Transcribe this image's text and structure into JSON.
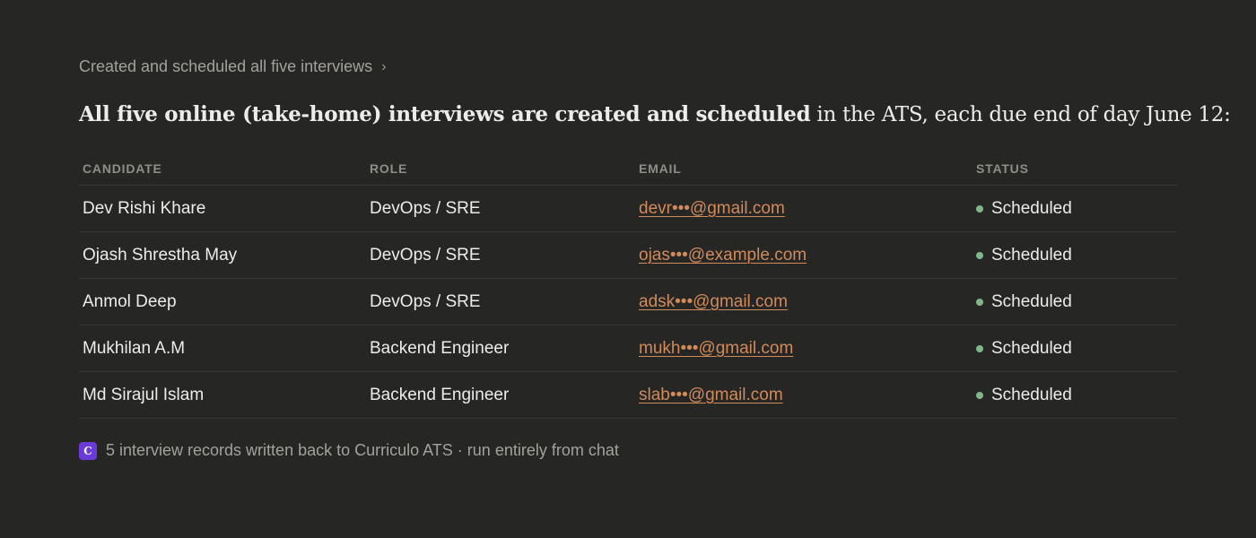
{
  "breadcrumb": {
    "label": "Created and scheduled all five interviews",
    "chevron": "›"
  },
  "headline": {
    "bold": "All five online (take-home) interviews are created and scheduled",
    "rest": " in the ATS, each due end of day June 12:"
  },
  "table": {
    "headers": {
      "candidate": "CANDIDATE",
      "role": "ROLE",
      "email": "EMAIL",
      "status": "STATUS"
    },
    "rows": [
      {
        "candidate": "Dev Rishi Khare",
        "role": "DevOps / SRE",
        "email": "devr•••@gmail.com",
        "status": "Scheduled"
      },
      {
        "candidate": "Ojash Shrestha May",
        "role": "DevOps / SRE",
        "email": "ojas•••@example.com",
        "status": "Scheduled"
      },
      {
        "candidate": "Anmol Deep",
        "role": "DevOps / SRE",
        "email": "adsk•••@gmail.com",
        "status": "Scheduled"
      },
      {
        "candidate": "Mukhilan A.M",
        "role": "Backend Engineer",
        "email": "mukh•••@gmail.com",
        "status": "Scheduled"
      },
      {
        "candidate": "Md Sirajul Islam",
        "role": "Backend Engineer",
        "email": "slab•••@gmail.com",
        "status": "Scheduled"
      }
    ]
  },
  "footer": {
    "logo_letter": "C",
    "text": "5 interview records written back to Curriculo ATS · run entirely from chat"
  },
  "colors": {
    "background": "#262624",
    "email_link": "#d08a5c",
    "status_dot": "#7fb78a",
    "logo_bg": "#6b3bd9"
  }
}
